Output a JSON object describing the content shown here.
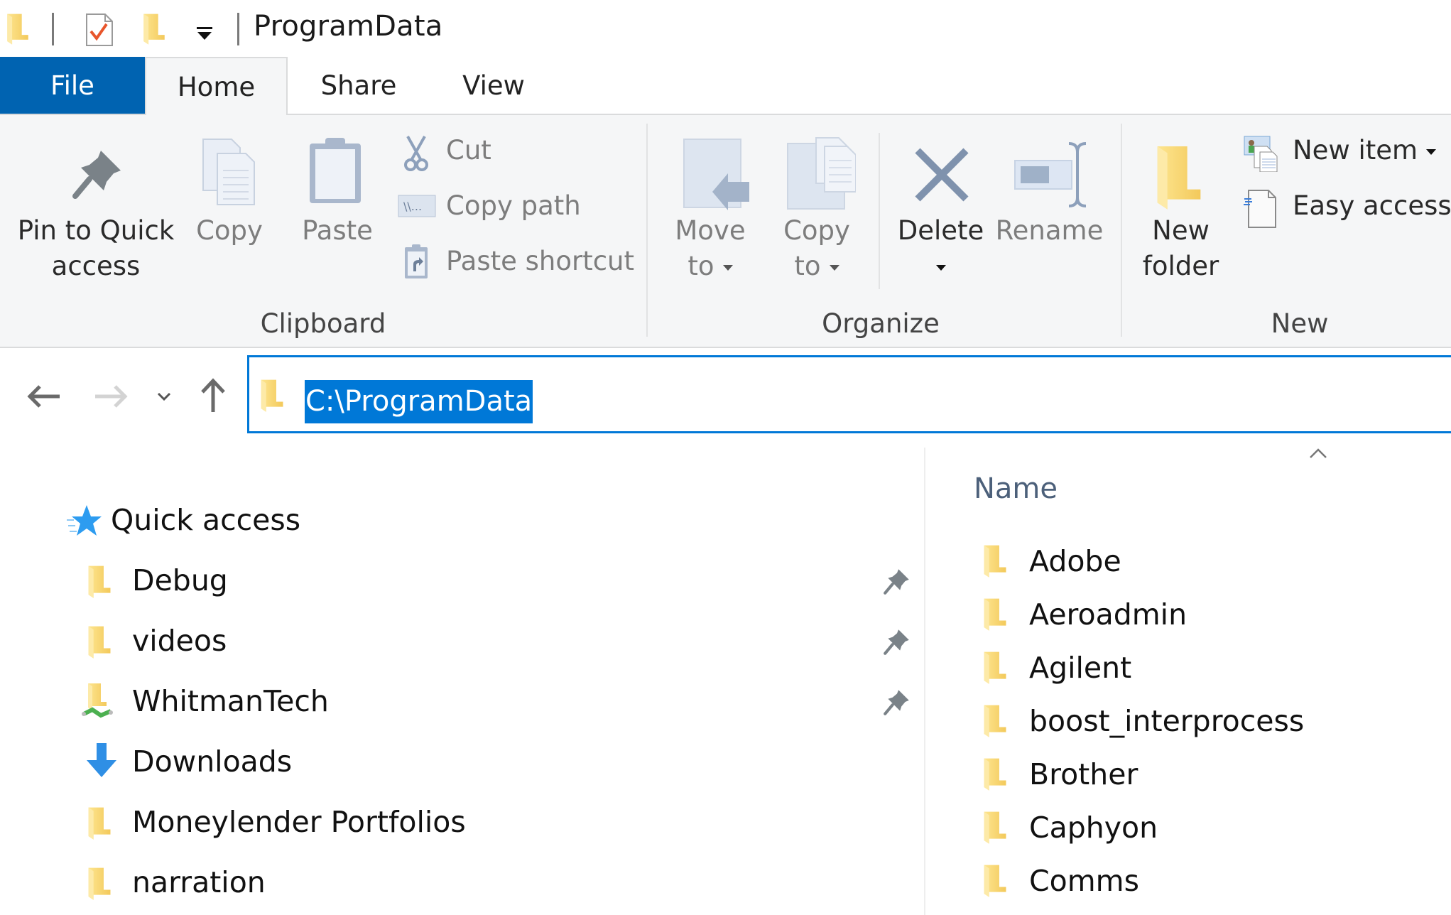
{
  "window": {
    "title": "ProgramData",
    "quick_access_toolbar": [
      {
        "icon": "folder-icon"
      },
      {
        "icon": "properties-checkmark-icon"
      },
      {
        "icon": "new-folder-icon"
      },
      {
        "icon": "customize-dropdown-icon"
      }
    ]
  },
  "ribbon": {
    "tabs": [
      {
        "label": "File",
        "active": false,
        "style": "backstage"
      },
      {
        "label": "Home",
        "active": true
      },
      {
        "label": "Share",
        "active": false
      },
      {
        "label": "View",
        "active": false
      }
    ],
    "groups": {
      "clipboard": {
        "label": "Clipboard",
        "pin_line1": "Pin to Quick",
        "pin_line2": "access",
        "copy": "Copy",
        "paste": "Paste",
        "cut": "Cut",
        "copy_path": "Copy path",
        "paste_shortcut": "Paste shortcut"
      },
      "organize": {
        "label": "Organize",
        "move_line1": "Move",
        "move_line2": "to",
        "copy_line1": "Copy",
        "copy_line2": "to",
        "delete": "Delete",
        "rename": "Rename"
      },
      "new": {
        "label": "New",
        "folder_line1": "New",
        "folder_line2": "folder",
        "new_item": "New item",
        "easy_access": "Easy access"
      }
    }
  },
  "address_bar": {
    "path": "C:\\ProgramData",
    "selected": true
  },
  "navigation_pane": {
    "header": "Quick access",
    "items": [
      {
        "label": "Debug",
        "icon": "folder-icon",
        "pinned": true
      },
      {
        "label": "videos",
        "icon": "folder-icon",
        "pinned": true
      },
      {
        "label": "WhitmanTech",
        "icon": "network-folder-icon",
        "pinned": true
      },
      {
        "label": "Downloads",
        "icon": "download-arrow-icon",
        "pinned": false
      },
      {
        "label": "Moneylender Portfolios",
        "icon": "folder-icon",
        "pinned": false
      },
      {
        "label": "narration",
        "icon": "folder-icon",
        "pinned": false
      }
    ]
  },
  "file_list": {
    "column_header": "Name",
    "sort": "ascending",
    "items": [
      {
        "name": "Adobe"
      },
      {
        "name": "Aeroadmin"
      },
      {
        "name": "Agilent"
      },
      {
        "name": "boost_interprocess"
      },
      {
        "name": "Brother"
      },
      {
        "name": "Caphyon"
      },
      {
        "name": "Comms"
      }
    ]
  },
  "colors": {
    "accent": "#0078d7",
    "file_tab": "#0063b1",
    "ribbon_bg": "#f5f6f7",
    "folder": "#f8d775"
  }
}
